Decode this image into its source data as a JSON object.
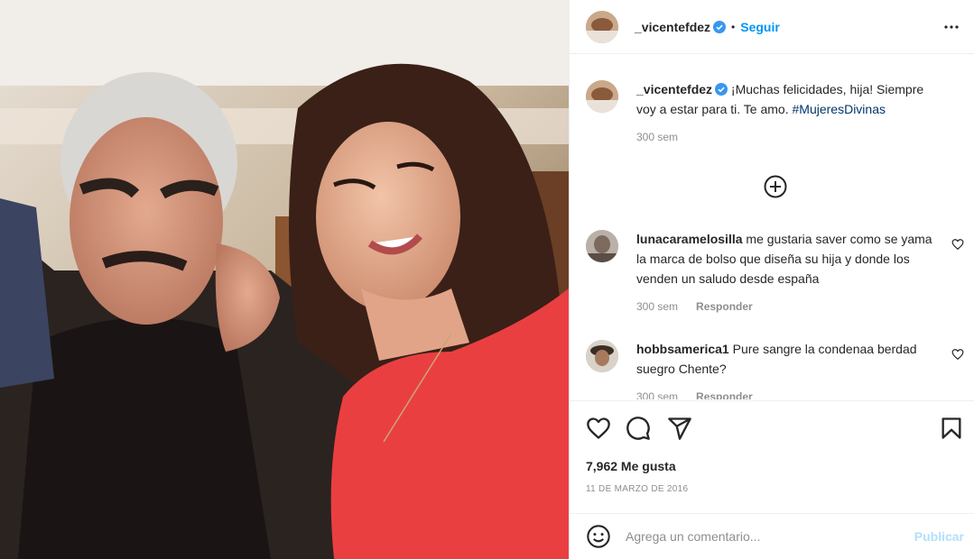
{
  "post": {
    "author": "_vicentefdez",
    "follow_label": "Seguir",
    "dot": "•",
    "caption": {
      "author": "_vicentefdez",
      "text": " ¡Muchas felicidades, hija! Siempre voy a estar para ti. Te amo. ",
      "hashtag": "#MujeresDivinas",
      "time": "300 sem"
    },
    "comments": [
      {
        "user": "lunacaramelosilla",
        "text": " me gustaria saver como se yama la marca de bolso que diseña su hija y donde los venden un saludo desde españa",
        "time": "300 sem",
        "reply_label": "Responder"
      },
      {
        "user": "hobbsamerica1",
        "text": " Pure sangre la condenaa berdad suegro Chente?",
        "time": "300 sem",
        "reply_label": "Responder"
      }
    ],
    "likes": "7,962 Me gusta",
    "date": "11 DE MARZO DE 2016",
    "composer": {
      "placeholder": "Agrega un comentario...",
      "publish_label": "Publicar"
    }
  },
  "colors": {
    "link_blue": "#0095f6",
    "hashtag_blue": "#00376b",
    "verified_blue": "#3897f0",
    "muted_text": "#8e8e8e",
    "publish_disabled": "#b2dffc"
  },
  "icons": [
    "verified-badge-icon",
    "more-options-icon",
    "add-circle-icon",
    "heart-icon",
    "comment-icon",
    "share-icon",
    "bookmark-icon",
    "emoji-icon"
  ]
}
